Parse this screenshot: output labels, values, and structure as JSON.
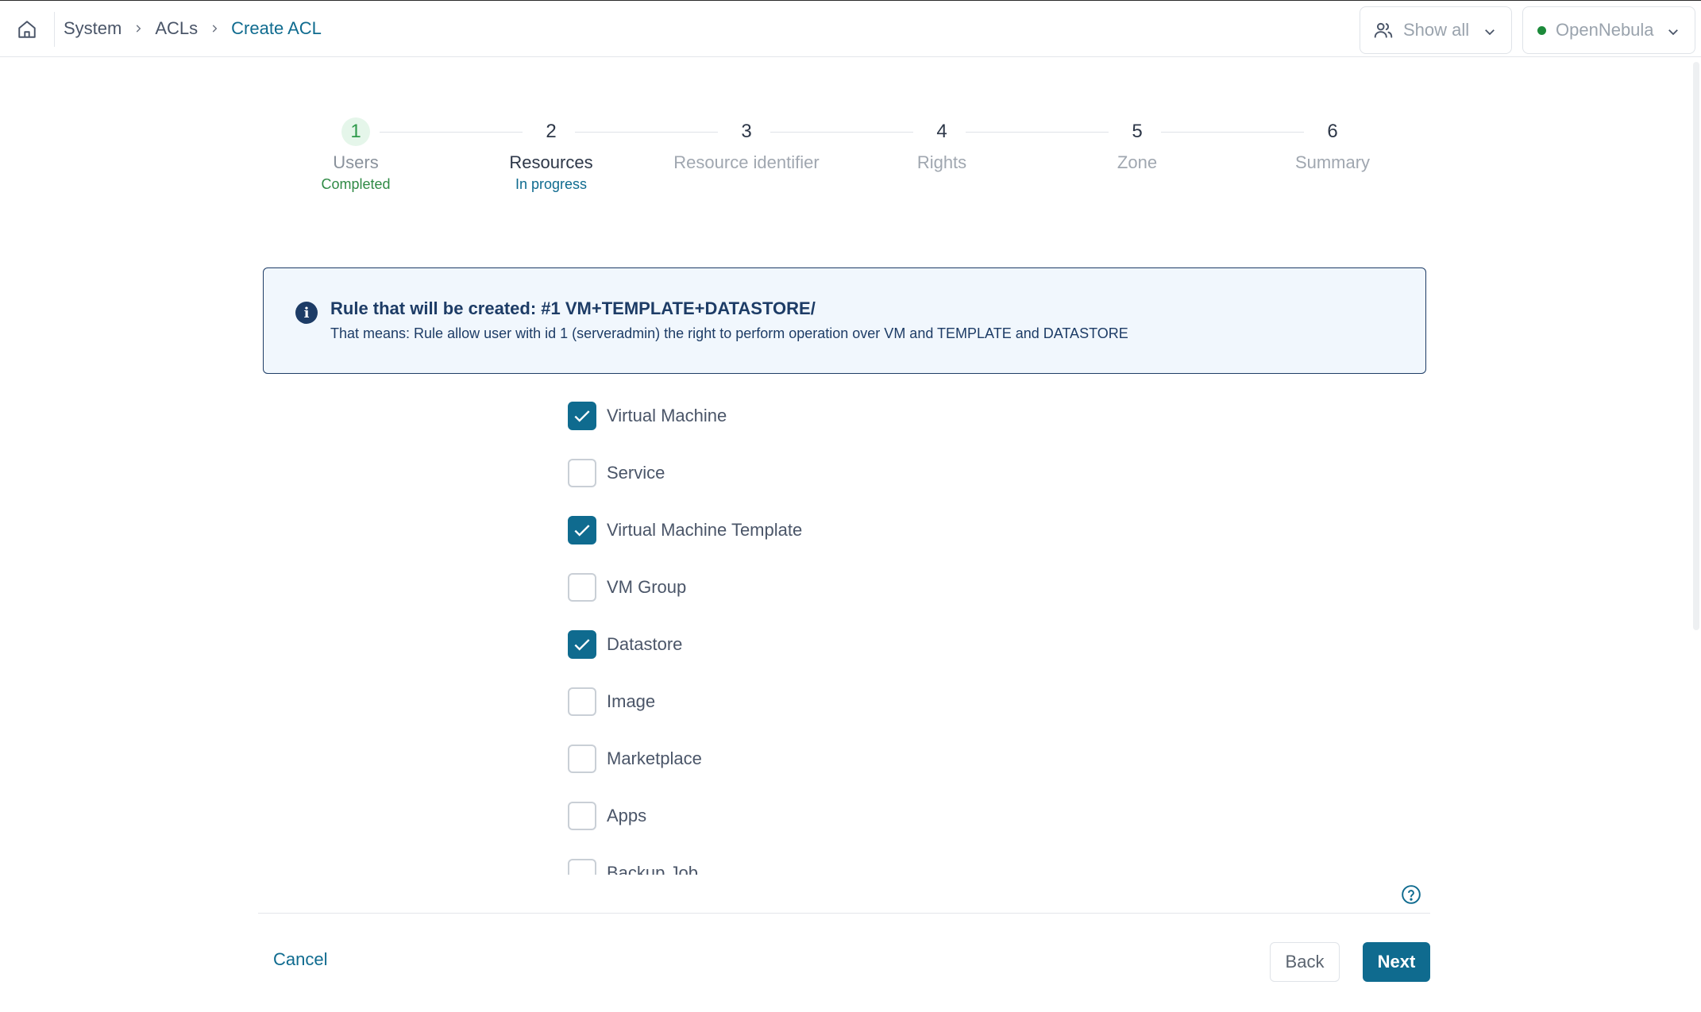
{
  "header": {
    "breadcrumb": [
      "System",
      "ACLs",
      "Create ACL"
    ],
    "users_filter_label": "Show all",
    "zone_label": "OpenNebula",
    "zone_status_color": "#1c8a3a"
  },
  "stepper": {
    "steps": [
      {
        "number": "1",
        "label": "Users",
        "status": "Completed"
      },
      {
        "number": "2",
        "label": "Resources",
        "status": "In progress"
      },
      {
        "number": "3",
        "label": "Resource identifier",
        "status": ""
      },
      {
        "number": "4",
        "label": "Rights",
        "status": ""
      },
      {
        "number": "5",
        "label": "Zone",
        "status": ""
      },
      {
        "number": "6",
        "label": "Summary",
        "status": ""
      }
    ]
  },
  "info": {
    "title": "Rule that will be created: #1 VM+TEMPLATE+DATASTORE/",
    "text": "That means: Rule allow user with id 1 (serveradmin) the right to perform operation over VM and TEMPLATE and DATASTORE"
  },
  "resources": {
    "items": [
      {
        "label": "Virtual Machine",
        "checked": true
      },
      {
        "label": "Service",
        "checked": false
      },
      {
        "label": "Virtual Machine Template",
        "checked": true
      },
      {
        "label": "VM Group",
        "checked": false
      },
      {
        "label": "Datastore",
        "checked": true
      },
      {
        "label": "Image",
        "checked": false
      },
      {
        "label": "Marketplace",
        "checked": false
      },
      {
        "label": "Apps",
        "checked": false
      },
      {
        "label": "Backup Job",
        "checked": false
      }
    ]
  },
  "footer": {
    "cancel_label": "Cancel",
    "back_label": "Back",
    "next_label": "Next"
  },
  "colors": {
    "accent": "#0f6b8f",
    "info_border": "#1d3c66",
    "info_bg": "#f1f7fd",
    "completed": "#2f8a45"
  }
}
